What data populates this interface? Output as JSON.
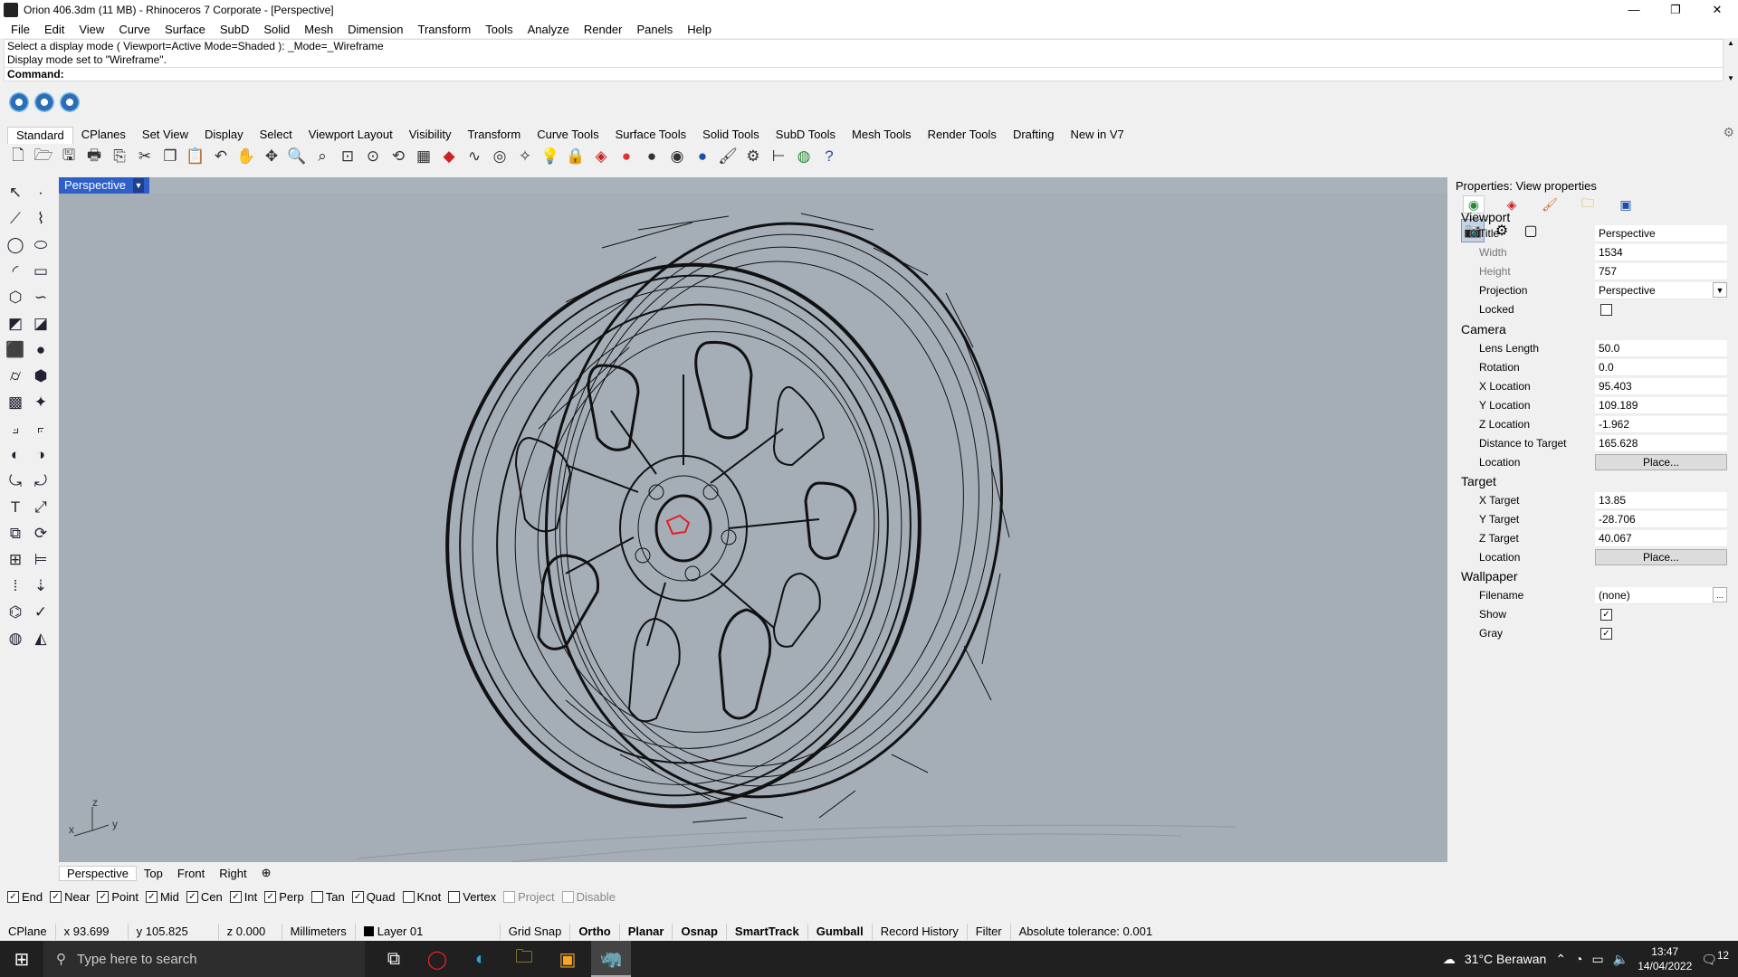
{
  "window": {
    "title": "Orion 406.3dm (11 MB) - Rhinoceros 7 Corporate - [Perspective]",
    "controls": [
      "—",
      "❐",
      "✕"
    ]
  },
  "menu": [
    "File",
    "Edit",
    "View",
    "Curve",
    "Surface",
    "SubD",
    "Solid",
    "Mesh",
    "Dimension",
    "Transform",
    "Tools",
    "Analyze",
    "Render",
    "Panels",
    "Help"
  ],
  "command": {
    "history": [
      "Select a display mode ( Viewport=Active  Mode=Shaded ): _Mode=_Wireframe",
      "Display mode set to \"Wireframe\"."
    ],
    "prompt": "Command:"
  },
  "toolbar_tabs": [
    "Standard",
    "CPlanes",
    "Set View",
    "Display",
    "Select",
    "Viewport Layout",
    "Visibility",
    "Transform",
    "Curve Tools",
    "Surface Tools",
    "Solid Tools",
    "SubD Tools",
    "Mesh Tools",
    "Render Tools",
    "Drafting",
    "New in V7"
  ],
  "toolbar_icons": [
    "new-icon",
    "open-icon",
    "save-icon",
    "print-icon",
    "import-icon",
    "cut-icon",
    "copy-icon",
    "paste-icon",
    "undo-icon",
    "pan-icon",
    "move-icon",
    "zoom-icon",
    "zoom-window-icon",
    "zoom-extents-icon",
    "zoom-selected-icon",
    "rotate-view-icon",
    "grid-icon",
    "car-icon",
    "curve-icon",
    "target-icon",
    "snap-icon",
    "light-icon",
    "lock-icon",
    "materials-icon",
    "color-icon",
    "sphere-icon",
    "shaded-icon",
    "render-icon",
    "brush-icon",
    "gear-icon",
    "dimension-icon",
    "globe-icon",
    "help-icon"
  ],
  "viewport": {
    "name": "Perspective",
    "tabs": [
      "Perspective",
      "Top",
      "Front",
      "Right"
    ],
    "axis_labels": {
      "x": "x",
      "y": "y",
      "z": "z"
    }
  },
  "osnaps": [
    {
      "label": "End",
      "checked": true
    },
    {
      "label": "Near",
      "checked": true
    },
    {
      "label": "Point",
      "checked": true
    },
    {
      "label": "Mid",
      "checked": true
    },
    {
      "label": "Cen",
      "checked": true
    },
    {
      "label": "Int",
      "checked": true
    },
    {
      "label": "Perp",
      "checked": true
    },
    {
      "label": "Tan",
      "checked": false
    },
    {
      "label": "Quad",
      "checked": true
    },
    {
      "label": "Knot",
      "checked": false
    },
    {
      "label": "Vertex",
      "checked": false
    },
    {
      "label": "Project",
      "checked": false,
      "disabled": true
    },
    {
      "label": "Disable",
      "checked": false,
      "disabled": true
    }
  ],
  "status": {
    "cplane": "CPlane",
    "x": "x 93.699",
    "y": "y 105.825",
    "z": "z 0.000",
    "units": "Millimeters",
    "layer": "Layer 01",
    "grid_snap": "Grid Snap",
    "ortho": "Ortho",
    "planar": "Planar",
    "osnap": "Osnap",
    "smarttrack": "SmartTrack",
    "gumball": "Gumball",
    "record_history": "Record History",
    "filter": "Filter",
    "tolerance": "Absolute tolerance: 0.001"
  },
  "properties": {
    "title": "Properties: View properties",
    "sections": {
      "viewport": "Viewport",
      "camera": "Camera",
      "target": "Target",
      "wallpaper": "Wallpaper"
    },
    "viewport": {
      "title_label": "Title",
      "title": "Perspective",
      "width_label": "Width",
      "width": "1534",
      "height_label": "Height",
      "height": "757",
      "projection_label": "Projection",
      "projection": "Perspective",
      "locked_label": "Locked",
      "locked": false
    },
    "camera": {
      "lens_label": "Lens Length",
      "lens": "50.0",
      "rotation_label": "Rotation",
      "rotation": "0.0",
      "xloc_label": "X Location",
      "xloc": "95.403",
      "yloc_label": "Y Location",
      "yloc": "109.189",
      "zloc_label": "Z Location",
      "zloc": "-1.962",
      "dist_label": "Distance to Target",
      "dist": "165.628",
      "location_label": "Location",
      "place": "Place..."
    },
    "target": {
      "x_label": "X Target",
      "x": "13.85",
      "y_label": "Y Target",
      "y": "-28.706",
      "z_label": "Z Target",
      "z": "40.067",
      "location_label": "Location",
      "place": "Place..."
    },
    "wallpaper": {
      "filename_label": "Filename",
      "filename": "(none)",
      "browse": "...",
      "show_label": "Show",
      "show": true,
      "gray_label": "Gray",
      "gray": true
    }
  },
  "taskbar": {
    "search_placeholder": "Type here to search",
    "weather": "31°C  Berawan",
    "time": "13:47",
    "date": "14/04/2022",
    "notifications": "12"
  },
  "colors": {
    "viewport_bg": "#a5adb7",
    "active_tab": "#2f5fc8",
    "wire": "#111111",
    "accent_red": "#e02020"
  }
}
